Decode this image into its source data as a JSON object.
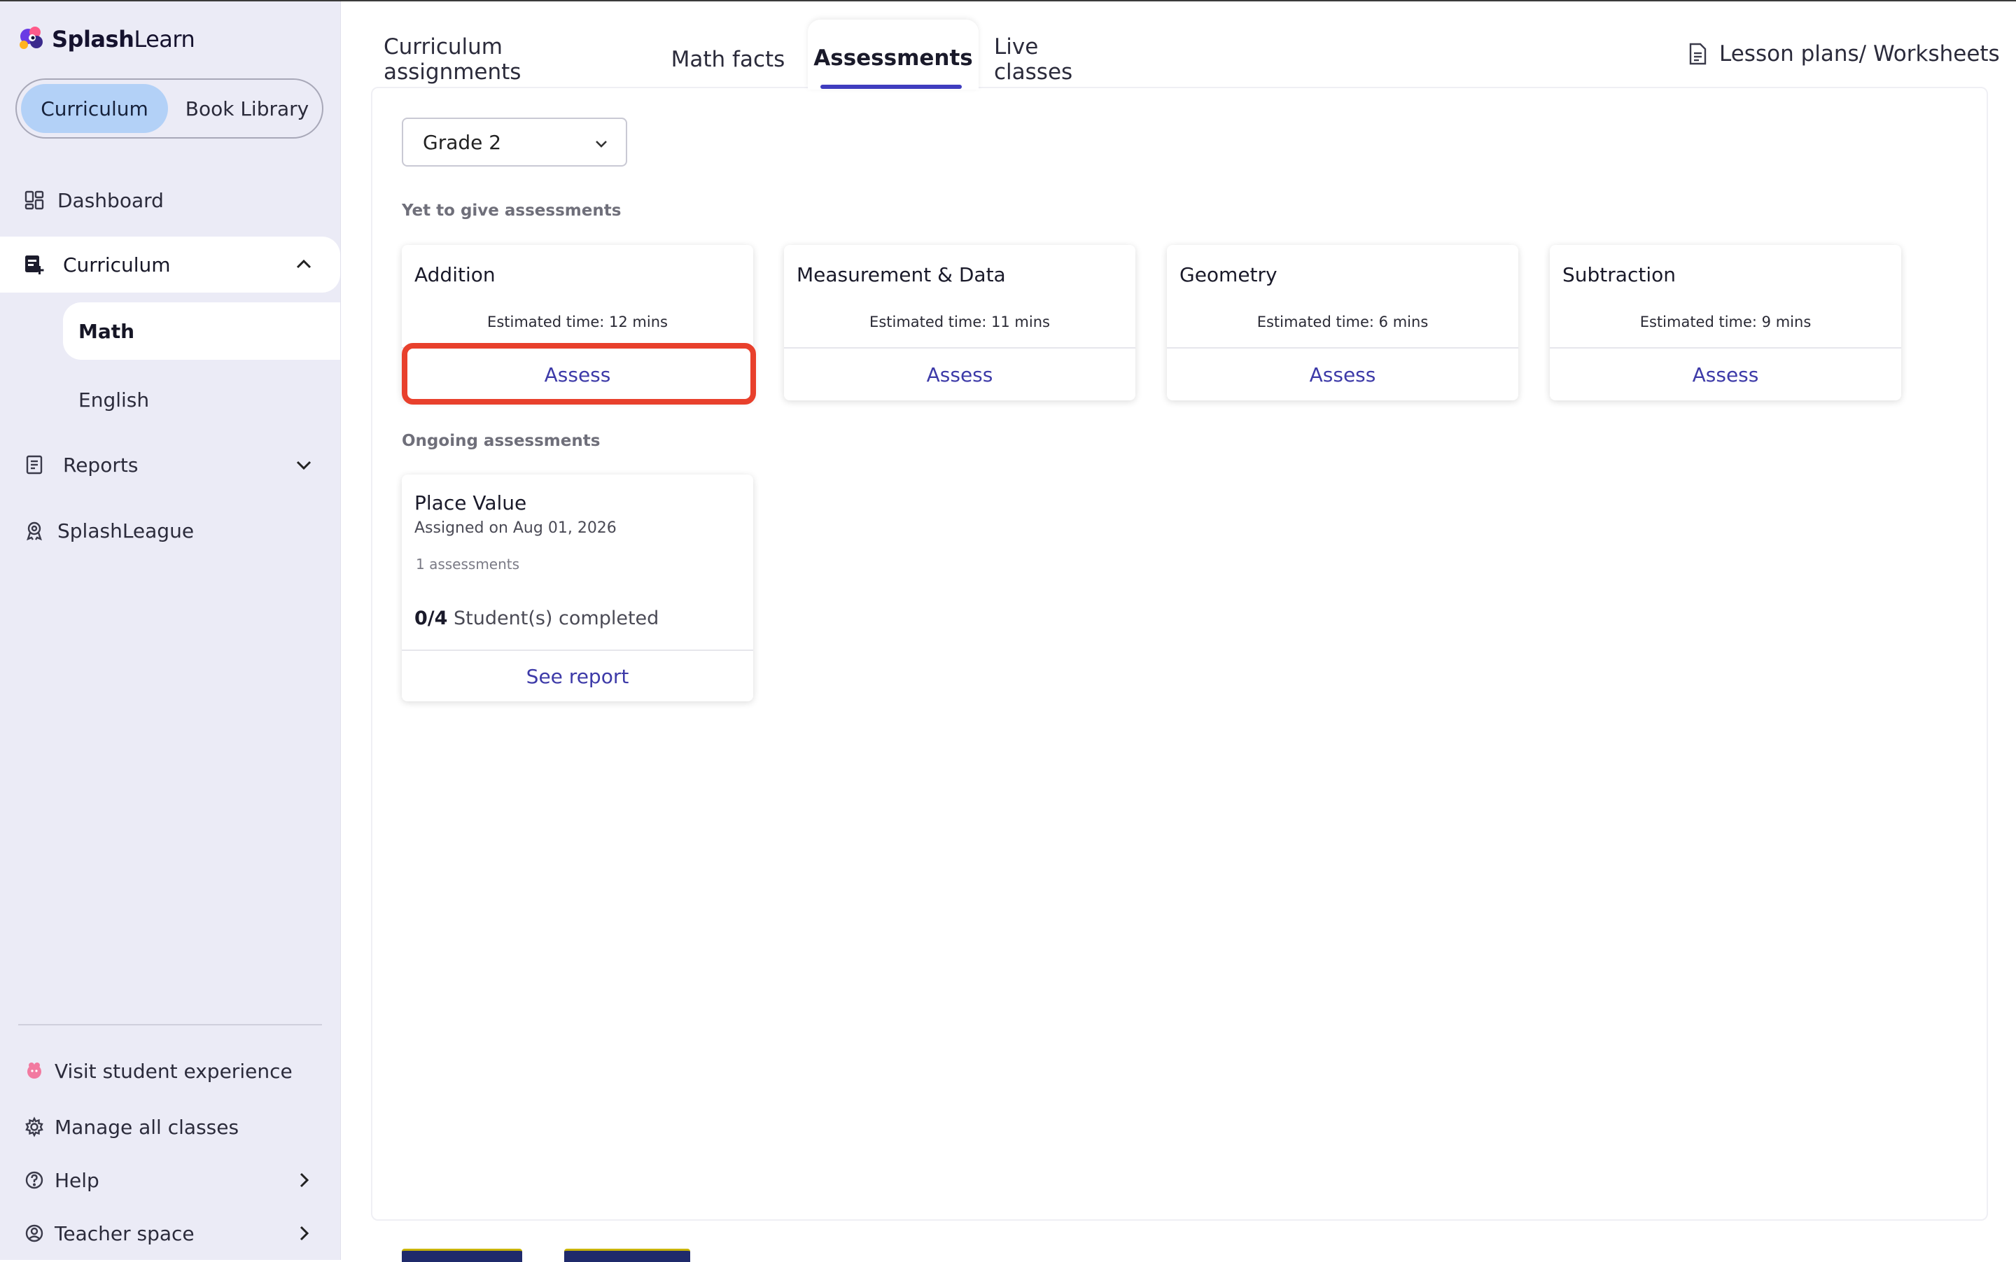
{
  "app": {
    "brand_bold": "Splash",
    "brand_light": "Learn"
  },
  "sidebar": {
    "segment": {
      "active": "Curriculum",
      "other": "Book Library"
    },
    "nav": {
      "dashboard": "Dashboard",
      "curriculum": "Curriculum",
      "math": "Math",
      "english": "English",
      "reports": "Reports",
      "splashleague": "SplashLeague"
    },
    "footer": {
      "visit": "Visit student experience",
      "manage": "Manage all classes",
      "help": "Help",
      "teacher": "Teacher space"
    }
  },
  "tabs": [
    "Curriculum assignments",
    "Math facts",
    "Assessments",
    "Live classes"
  ],
  "active_tab": "Assessments",
  "lesson_link": "Lesson plans/ Worksheets",
  "grade_select": {
    "value": "Grade 2"
  },
  "yet_to_give": {
    "label": "Yet to give assessments",
    "cards": [
      {
        "title": "Addition",
        "time": "Estimated time: 12 mins",
        "action": "Assess"
      },
      {
        "title": "Measurement & Data",
        "time": "Estimated time: 11 mins",
        "action": "Assess"
      },
      {
        "title": "Geometry",
        "time": "Estimated time: 6 mins",
        "action": "Assess"
      },
      {
        "title": "Subtraction",
        "time": "Estimated time: 9 mins",
        "action": "Assess"
      }
    ]
  },
  "ongoing": {
    "label": "Ongoing assessments",
    "cards": [
      {
        "title": "Place Value",
        "assigned": "Assigned on Aug 01, 2026",
        "count": "1 assessments",
        "progress_value": "0/4",
        "progress_text": "Student(s) completed",
        "action": "See report"
      }
    ]
  },
  "colors": {
    "accent": "#3f3dbf",
    "segment_active": "#b3d1f7",
    "sidebar_bg": "#ebebf6",
    "highlight": "#e8402c"
  }
}
